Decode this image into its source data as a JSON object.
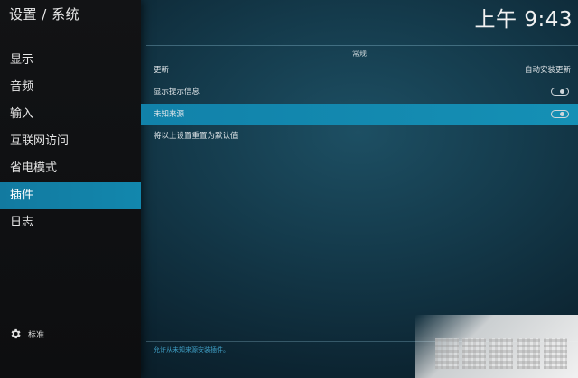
{
  "header": {
    "breadcrumb": "设置 / 系统",
    "clock": "上午 9:43"
  },
  "sidebar": {
    "items": [
      {
        "label": "显示",
        "active": false
      },
      {
        "label": "音频",
        "active": false
      },
      {
        "label": "输入",
        "active": false
      },
      {
        "label": "互联网访问",
        "active": false
      },
      {
        "label": "省电模式",
        "active": false
      },
      {
        "label": "插件",
        "active": true
      },
      {
        "label": "日志",
        "active": false
      }
    ],
    "level_icon": "gear-icon",
    "level_label": "标准"
  },
  "main": {
    "section_header": "常规",
    "rows": [
      {
        "label": "更新",
        "value": "自动安装更新",
        "type": "value"
      },
      {
        "label": "显示提示信息",
        "type": "toggle",
        "enabled": false
      },
      {
        "label": "未知来源",
        "type": "toggle",
        "enabled": false,
        "highlighted": true
      },
      {
        "label": "将以上设置重置为默认值",
        "type": "action"
      }
    ],
    "help_text": "允许从未知来源安装插件。"
  },
  "colors": {
    "accent": "#1287ad",
    "sidebar_bg": "#121315",
    "help_text": "#3f9fc5"
  }
}
